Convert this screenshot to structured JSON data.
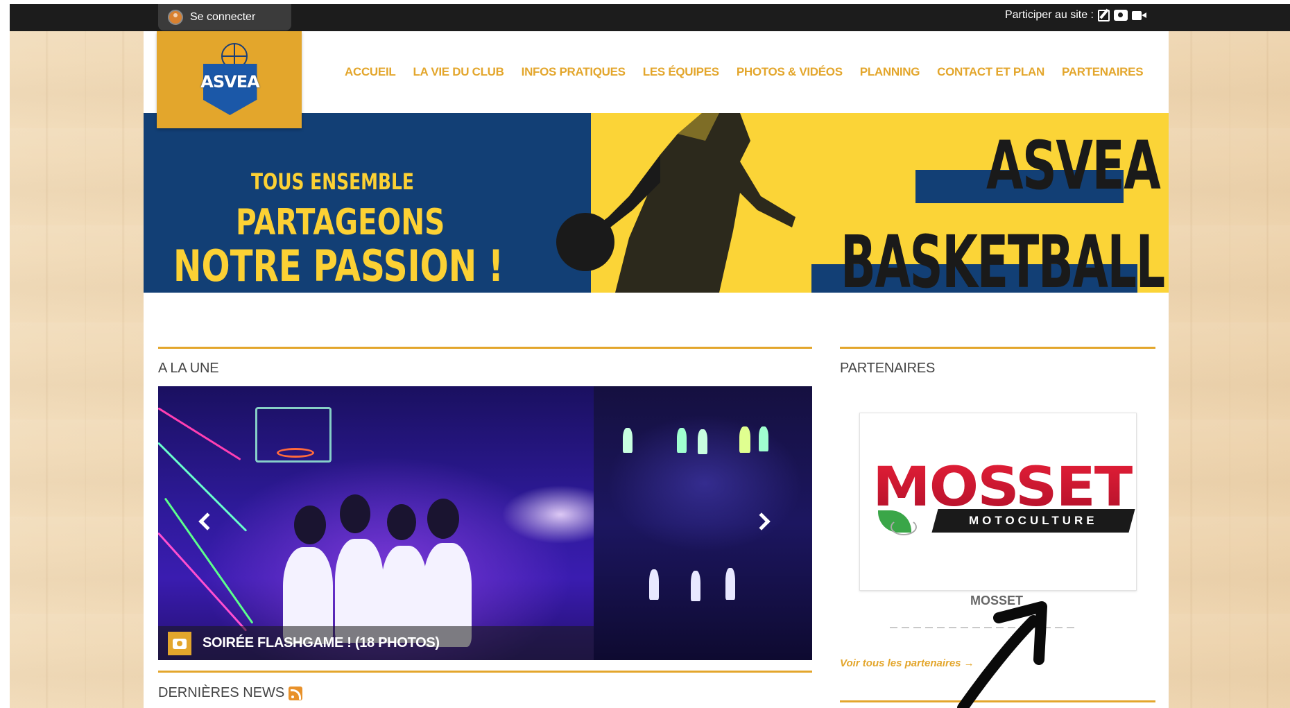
{
  "topbar": {
    "login_label": "Se connecter",
    "participer_label": "Participer au site :",
    "icons": [
      "edit-icon",
      "camera-icon",
      "video-icon"
    ]
  },
  "logo": {
    "text": "ASVEA"
  },
  "nav": {
    "items": [
      "ACCUEIL",
      "LA VIE DU CLUB",
      "INFOS PRATIQUES",
      "LES ÉQUIPES",
      "PHOTOS & VIDÉOS",
      "PLANNING",
      "CONTACT ET PLAN",
      "PARTENAIRES"
    ]
  },
  "banner": {
    "line1": "TOUS ENSEMBLE",
    "line2": "PARTAGEONS",
    "line3": "NOTRE PASSION !",
    "club": "ASVEA",
    "sport": "BASKETBALL"
  },
  "a_la_une": {
    "title": "A LA UNE",
    "caption": "SOIRÉE FLASHGAME ! (18 PHOTOS)"
  },
  "news": {
    "title": "DERNIÈRES NEWS"
  },
  "partenaires": {
    "title": "PARTENAIRES",
    "logo_main": "MOSSET",
    "logo_sub": "MOTOCULTURE",
    "name": "MOSSET",
    "see_all": "Voir tous les partenaires →"
  },
  "colors": {
    "accent": "#e3a62c",
    "navy": "#123f75",
    "yellow": "#fbd437",
    "topbar": "#1c1c1c"
  }
}
